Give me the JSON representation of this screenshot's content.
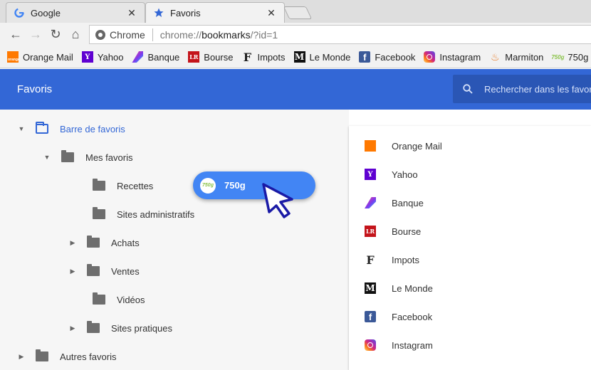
{
  "tabs": [
    {
      "title": "Google",
      "close": "✕",
      "favicon": "google-icon"
    },
    {
      "title": "Favoris",
      "close": "✕",
      "favicon": "star-icon"
    }
  ],
  "nav": {
    "back": "←",
    "forward": "→",
    "reload": "↻",
    "home": "⌂"
  },
  "omnibox": {
    "scheme_label": "Chrome",
    "url_prefix": "chrome://",
    "url_host": "bookmarks",
    "url_suffix": "/?id=1"
  },
  "bookmarks_bar": [
    {
      "label": "Orange Mail",
      "icon": "orange-icon",
      "glyph": "orange"
    },
    {
      "label": "Yahoo",
      "icon": "yahoo-icon",
      "glyph": "Y"
    },
    {
      "label": "Banque",
      "icon": "banque-icon",
      "glyph": ""
    },
    {
      "label": "Bourse",
      "icon": "bourse-icon",
      "glyph": "LR"
    },
    {
      "label": "Impots",
      "icon": "impots-icon",
      "glyph": "F"
    },
    {
      "label": "Le Monde",
      "icon": "le-monde-icon",
      "glyph": "M"
    },
    {
      "label": "Facebook",
      "icon": "facebook-icon",
      "glyph": "f"
    },
    {
      "label": "Instagram",
      "icon": "instagram-icon",
      "glyph": ""
    },
    {
      "label": "Marmiton",
      "icon": "marmiton-icon",
      "glyph": "♨"
    },
    {
      "label": "750g",
      "icon": "750g-icon",
      "glyph": "750g"
    }
  ],
  "header": {
    "title": "Favoris",
    "search_placeholder": "Rechercher dans les favoris"
  },
  "tree": {
    "bar": "Barre de favoris",
    "mes_favoris": "Mes favoris",
    "recettes": "Recettes",
    "sites_admin": "Sites administratifs",
    "achats": "Achats",
    "ventes": "Ventes",
    "videos": "Vidéos",
    "sites_pratiques": "Sites pratiques",
    "autres": "Autres favoris"
  },
  "list": [
    {
      "label": "Orange Mail",
      "icon": "orange-icon"
    },
    {
      "label": "Yahoo",
      "icon": "yahoo-icon"
    },
    {
      "label": "Banque",
      "icon": "banque-icon"
    },
    {
      "label": "Bourse",
      "icon": "bourse-icon"
    },
    {
      "label": "Impots",
      "icon": "impots-icon"
    },
    {
      "label": "Le Monde",
      "icon": "le-monde-icon"
    },
    {
      "label": "Facebook",
      "icon": "facebook-icon"
    },
    {
      "label": "Instagram",
      "icon": "instagram-icon"
    }
  ],
  "drag_chip": {
    "label": "750g",
    "badge": "750g"
  },
  "colors": {
    "accent": "#3367d6",
    "chip": "#4285f4",
    "cursor": "#1a1aa6"
  }
}
